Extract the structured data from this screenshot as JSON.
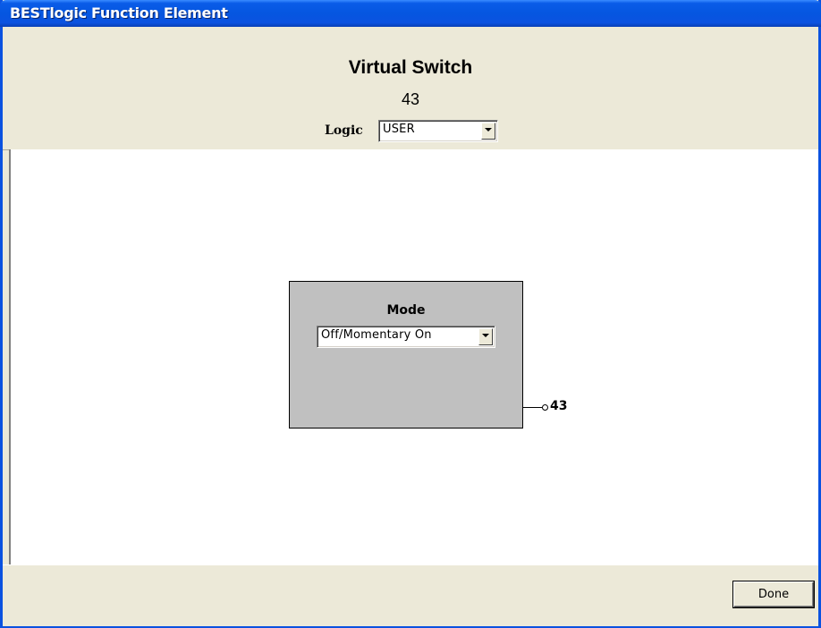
{
  "window": {
    "title": "BESTlogic Function Element"
  },
  "header": {
    "heading": "Virtual Switch",
    "number": "43",
    "logic_label": "Logic",
    "logic_value": "USER"
  },
  "block": {
    "mode_label": "Mode",
    "mode_value": "Off/Momentary On",
    "output_label": "43"
  },
  "footer": {
    "done_label": "Done"
  },
  "icons": {
    "dropdown": "chevron-down-icon"
  },
  "colors": {
    "titlebar": "#0b52e0",
    "dialog_bg": "#ece9d8",
    "block_bg": "#c0c0c0",
    "canvas_bg": "#ffffff"
  }
}
